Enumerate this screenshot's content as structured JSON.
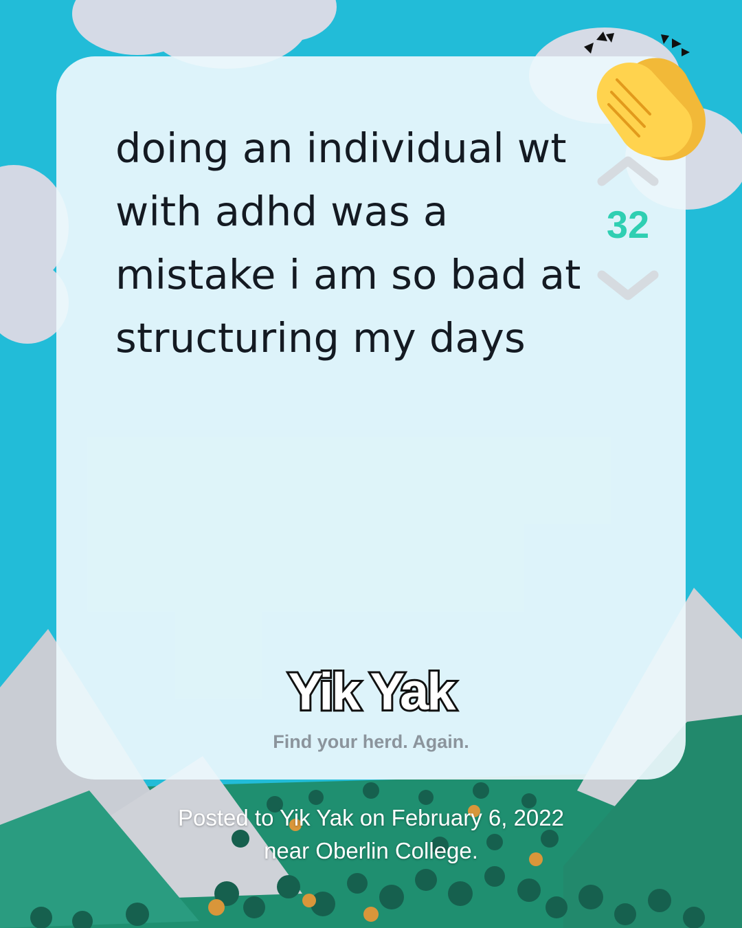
{
  "post": {
    "text": "doing an individual wt with adhd was a mistake i am so bad at structuring my days",
    "vote_count": "32"
  },
  "brand": {
    "logo_text": "Yik Yak",
    "tagline": "Find your herd. Again."
  },
  "footer": {
    "caption": "Posted to Yik Yak on February 6, 2022 near Oberlin College."
  },
  "icons": {
    "upvote": "chevron-up-icon",
    "downvote": "chevron-down-icon",
    "reaction": "clapping-hands-icon"
  },
  "colors": {
    "background": "#22bcd8",
    "vote_count": "#2fcfb2",
    "text": "#141a22",
    "tagline": "#8b949c"
  }
}
